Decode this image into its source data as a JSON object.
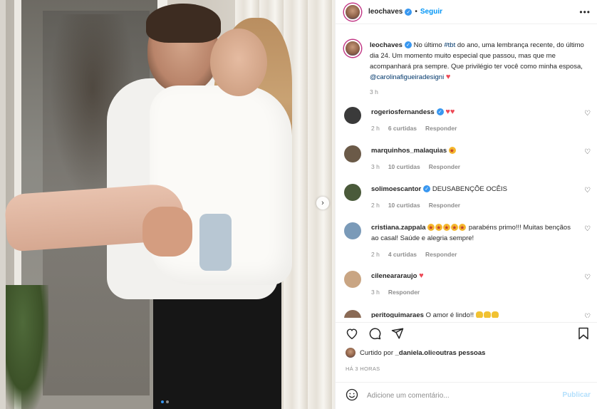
{
  "post": {
    "username": "leochaves",
    "follow_label": "Seguir",
    "more_label": "•••",
    "caption": {
      "username": "leochaves",
      "text_1": " No último ",
      "hashtag": "#tbt",
      "text_2": " do ano, uma lembrança recente, do último dia 24. Um momento muito especial que passou, mas que me acompanhará pra sempre. Que privilégio ter você como minha esposa, ",
      "mention": "@carolinafigueiradesigni",
      "time": "3 h"
    },
    "comments": [
      {
        "username": "rogeriosfernandess",
        "verified": true,
        "text": "",
        "time": "2 h",
        "likes": "6 curtidas",
        "reply": "Responder",
        "avatar_color": "#3a3a3a"
      },
      {
        "username": "marquinhos_malaquias",
        "verified": false,
        "text": "",
        "time": "3 h",
        "likes": "10 curtidas",
        "reply": "Responder",
        "avatar_color": "#6b5a48"
      },
      {
        "username": "solimoescantor",
        "verified": true,
        "text": "DEUSABENÇÕE OCÊIS",
        "time": "2 h",
        "likes": "10 curtidas",
        "reply": "Responder",
        "avatar_color": "#4a5a3a"
      },
      {
        "username": "cristiana.zappala",
        "verified": false,
        "text": " parabéns primo!!! Muitas bençãos ao casal! Saúde e alegria sempre!",
        "time": "2 h",
        "likes": "4 curtidas",
        "reply": "Responder",
        "avatar_color": "#7a9ab8"
      },
      {
        "username": "cileneararaujo",
        "verified": false,
        "text": "",
        "time": "3 h",
        "likes": "",
        "reply": "Responder",
        "avatar_color": "#c9a583"
      },
      {
        "username": "peritoguimaraes",
        "verified": false,
        "text": "O amor é lindo!!",
        "time": "",
        "likes": "",
        "reply": "",
        "avatar_color": "#8a6a55"
      }
    ],
    "likes_prefix": "Curtido por ",
    "likes_user": "_daniela.oli",
    "likes_mid": " e ",
    "likes_others": "outras pessoas",
    "timestamp": "HÁ 3 HORAS",
    "comment_placeholder": "Adicione um comentário...",
    "publish_label": "Publicar"
  },
  "icons": {
    "like": "heart-outline-icon",
    "comment": "comment-bubble-icon",
    "share": "paper-plane-icon",
    "save": "bookmark-icon",
    "emoji": "smiley-icon",
    "next": "chevron-right-icon"
  },
  "colors": {
    "accent": "#0095f6",
    "heart": "#ed4956",
    "muted": "#8e8e8e",
    "publish_disabled": "#b2dffc"
  },
  "carousel": {
    "total": 2,
    "active": 1
  }
}
